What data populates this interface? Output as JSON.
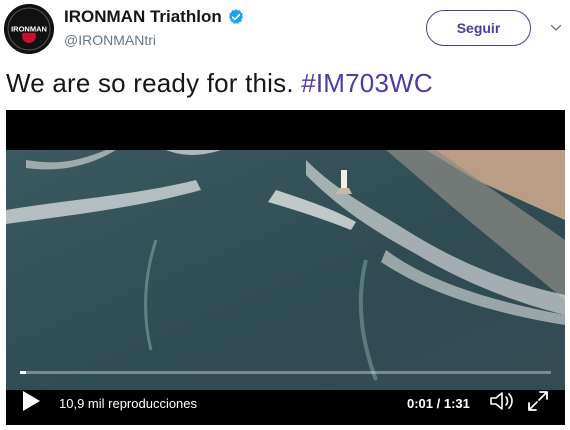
{
  "tweet": {
    "author": {
      "display_name": "IRONMAN Triathlon",
      "handle": "@IRONMANtri",
      "verified": true,
      "avatar_text": "IRONMAN"
    },
    "follow_button_label": "Seguir",
    "text": "We are so ready for this. ",
    "hashtag": "#IM703WC",
    "colors": {
      "accent": "#4b3aa8",
      "verified": "#1da1f2",
      "text": "#14171a",
      "muted": "#657786"
    }
  },
  "video": {
    "views_label": "10,9 mil reproducciones",
    "time_label": "0:01 / 1:31",
    "progress_fraction": 0.012,
    "icons": {
      "play": "play-icon",
      "volume": "volume-icon",
      "fullscreen": "fullscreen-icon",
      "menu": "chevron-down-icon"
    }
  }
}
